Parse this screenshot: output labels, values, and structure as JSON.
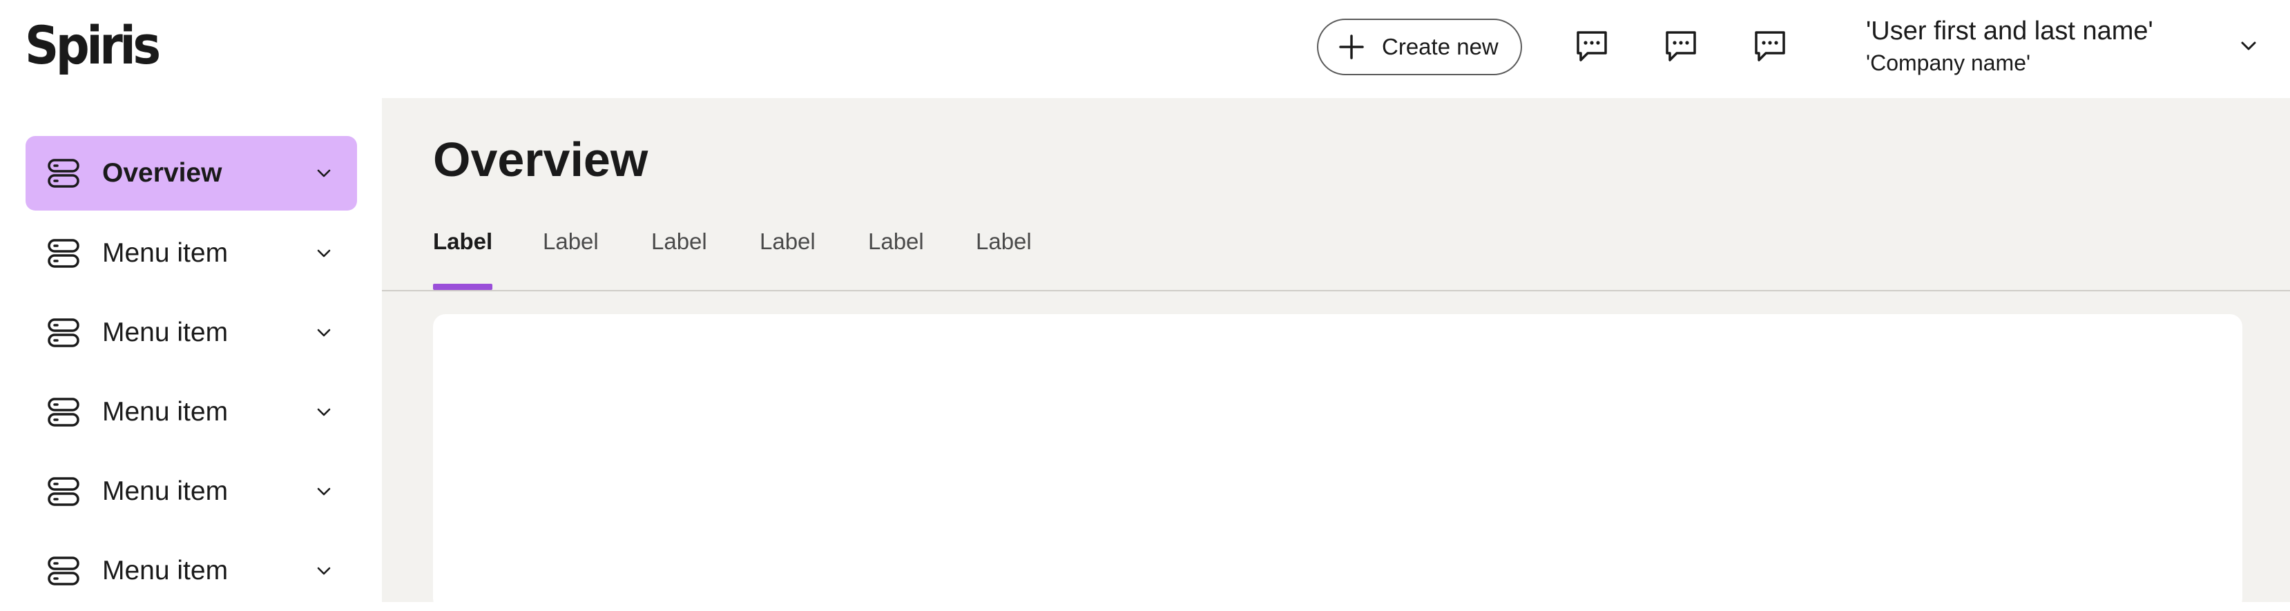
{
  "header": {
    "logo": "Spiris",
    "create_button_label": "Create new",
    "chat_icons": [
      "chat-icon",
      "chat-icon",
      "chat-icon"
    ],
    "user_name": "'User first and last name'",
    "company_name": "'Company name'"
  },
  "sidebar": {
    "items": [
      {
        "label": "Overview",
        "active": true
      },
      {
        "label": "Menu item",
        "active": false
      },
      {
        "label": "Menu item",
        "active": false
      },
      {
        "label": "Menu item",
        "active": false
      },
      {
        "label": "Menu item",
        "active": false
      },
      {
        "label": "Menu item",
        "active": false
      }
    ]
  },
  "main": {
    "title": "Overview",
    "tabs": [
      {
        "label": "Label",
        "active": true
      },
      {
        "label": "Label",
        "active": false
      },
      {
        "label": "Label",
        "active": false
      },
      {
        "label": "Label",
        "active": false
      },
      {
        "label": "Label",
        "active": false
      },
      {
        "label": "Label",
        "active": false
      }
    ]
  },
  "colors": {
    "accent_purple": "#9a4fd9",
    "active_nav_bg": "#dcb3fa",
    "main_bg": "#f3f2ef"
  }
}
